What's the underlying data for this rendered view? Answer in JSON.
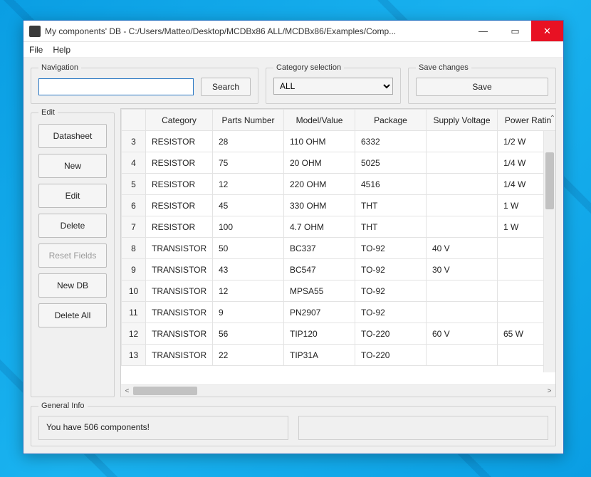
{
  "window": {
    "title": "My components' DB  -  C:/Users/Matteo/Desktop/MCDBx86 ALL/MCDBx86/Examples/Comp..."
  },
  "menu": {
    "file": "File",
    "help": "Help"
  },
  "nav": {
    "legend": "Navigation",
    "value": "",
    "search_label": "Search"
  },
  "category": {
    "legend": "Category selection",
    "selected": "ALL"
  },
  "save": {
    "legend": "Save changes",
    "label": "Save"
  },
  "edit": {
    "legend": "Edit",
    "datasheet": "Datasheet",
    "new": "New",
    "edit": "Edit",
    "delete": "Delete",
    "reset": "Reset Fields",
    "newdb": "New DB",
    "deleteall": "Delete All"
  },
  "table": {
    "columns": [
      "Category",
      "Parts Number",
      "Model/Value",
      "Package",
      "Supply Voltage",
      "Power Ratin"
    ],
    "rows": [
      {
        "n": "3",
        "cells": [
          "RESISTOR",
          "28",
          "110 OHM",
          "6332",
          "",
          "1/2 W"
        ]
      },
      {
        "n": "4",
        "cells": [
          "RESISTOR",
          "75",
          "20 OHM",
          "5025",
          "",
          "1/4 W"
        ]
      },
      {
        "n": "5",
        "cells": [
          "RESISTOR",
          "12",
          "220 OHM",
          "4516",
          "",
          "1/4 W"
        ]
      },
      {
        "n": "6",
        "cells": [
          "RESISTOR",
          "45",
          "330 OHM",
          "THT",
          "",
          "1 W"
        ]
      },
      {
        "n": "7",
        "cells": [
          "RESISTOR",
          "100",
          "4.7 OHM",
          "THT",
          "",
          "1 W"
        ]
      },
      {
        "n": "8",
        "cells": [
          "TRANSISTOR",
          "50",
          "BC337",
          "TO-92",
          "40 V",
          ""
        ]
      },
      {
        "n": "9",
        "cells": [
          "TRANSISTOR",
          "43",
          "BC547",
          "TO-92",
          "30 V",
          ""
        ]
      },
      {
        "n": "10",
        "cells": [
          "TRANSISTOR",
          "12",
          "MPSA55",
          "TO-92",
          "",
          ""
        ]
      },
      {
        "n": "11",
        "cells": [
          "TRANSISTOR",
          "9",
          "PN2907",
          "TO-92",
          "",
          ""
        ]
      },
      {
        "n": "12",
        "cells": [
          "TRANSISTOR",
          "56",
          "TIP120",
          "TO-220",
          "60 V",
          "65 W"
        ]
      },
      {
        "n": "13",
        "cells": [
          "TRANSISTOR",
          "22",
          "TIP31A",
          "TO-220",
          "",
          ""
        ]
      }
    ]
  },
  "info": {
    "legend": "General Info",
    "text": "You have 506 components!"
  }
}
